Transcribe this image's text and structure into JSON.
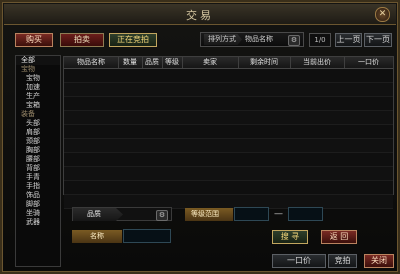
{
  "window": {
    "title": "交易",
    "close_icon": "close-icon"
  },
  "tabs": [
    {
      "label": "购买"
    },
    {
      "label": "拍卖"
    },
    {
      "label": "正在竞拍"
    }
  ],
  "sort": {
    "label": "排列方式",
    "value": "物品名称",
    "icon": "gear-icon"
  },
  "pager": {
    "page": "1/0",
    "prev": "上一页",
    "next": "下一页"
  },
  "sidebar": {
    "items": [
      {
        "label": "全部"
      },
      {
        "label": "宝物"
      },
      {
        "label": "宝物"
      },
      {
        "label": "加速"
      },
      {
        "label": "生产"
      },
      {
        "label": "宝箱"
      },
      {
        "label": "装备"
      },
      {
        "label": "头部"
      },
      {
        "label": "肩部"
      },
      {
        "label": "颈部"
      },
      {
        "label": "胸部"
      },
      {
        "label": "腰部"
      },
      {
        "label": "背部"
      },
      {
        "label": "手青"
      },
      {
        "label": "手指"
      },
      {
        "label": "饰品"
      },
      {
        "label": "脚部"
      },
      {
        "label": "坐骑"
      },
      {
        "label": "武器"
      }
    ]
  },
  "table": {
    "headers": [
      "物品名称",
      "数量",
      "品质",
      "等级",
      "卖家",
      "剩余时间",
      "当前出价",
      "一口价"
    ],
    "row_count": 10
  },
  "filters": {
    "quality_label": "品质",
    "quality_icon": "gear-icon",
    "grade_range_label": "等级范围",
    "range_separator": "—",
    "name_label": "名称"
  },
  "buttons": {
    "search": "搜 寻",
    "back": "返 回",
    "buyout": "一口价",
    "bid": "竞拍",
    "close": "关闭"
  }
}
